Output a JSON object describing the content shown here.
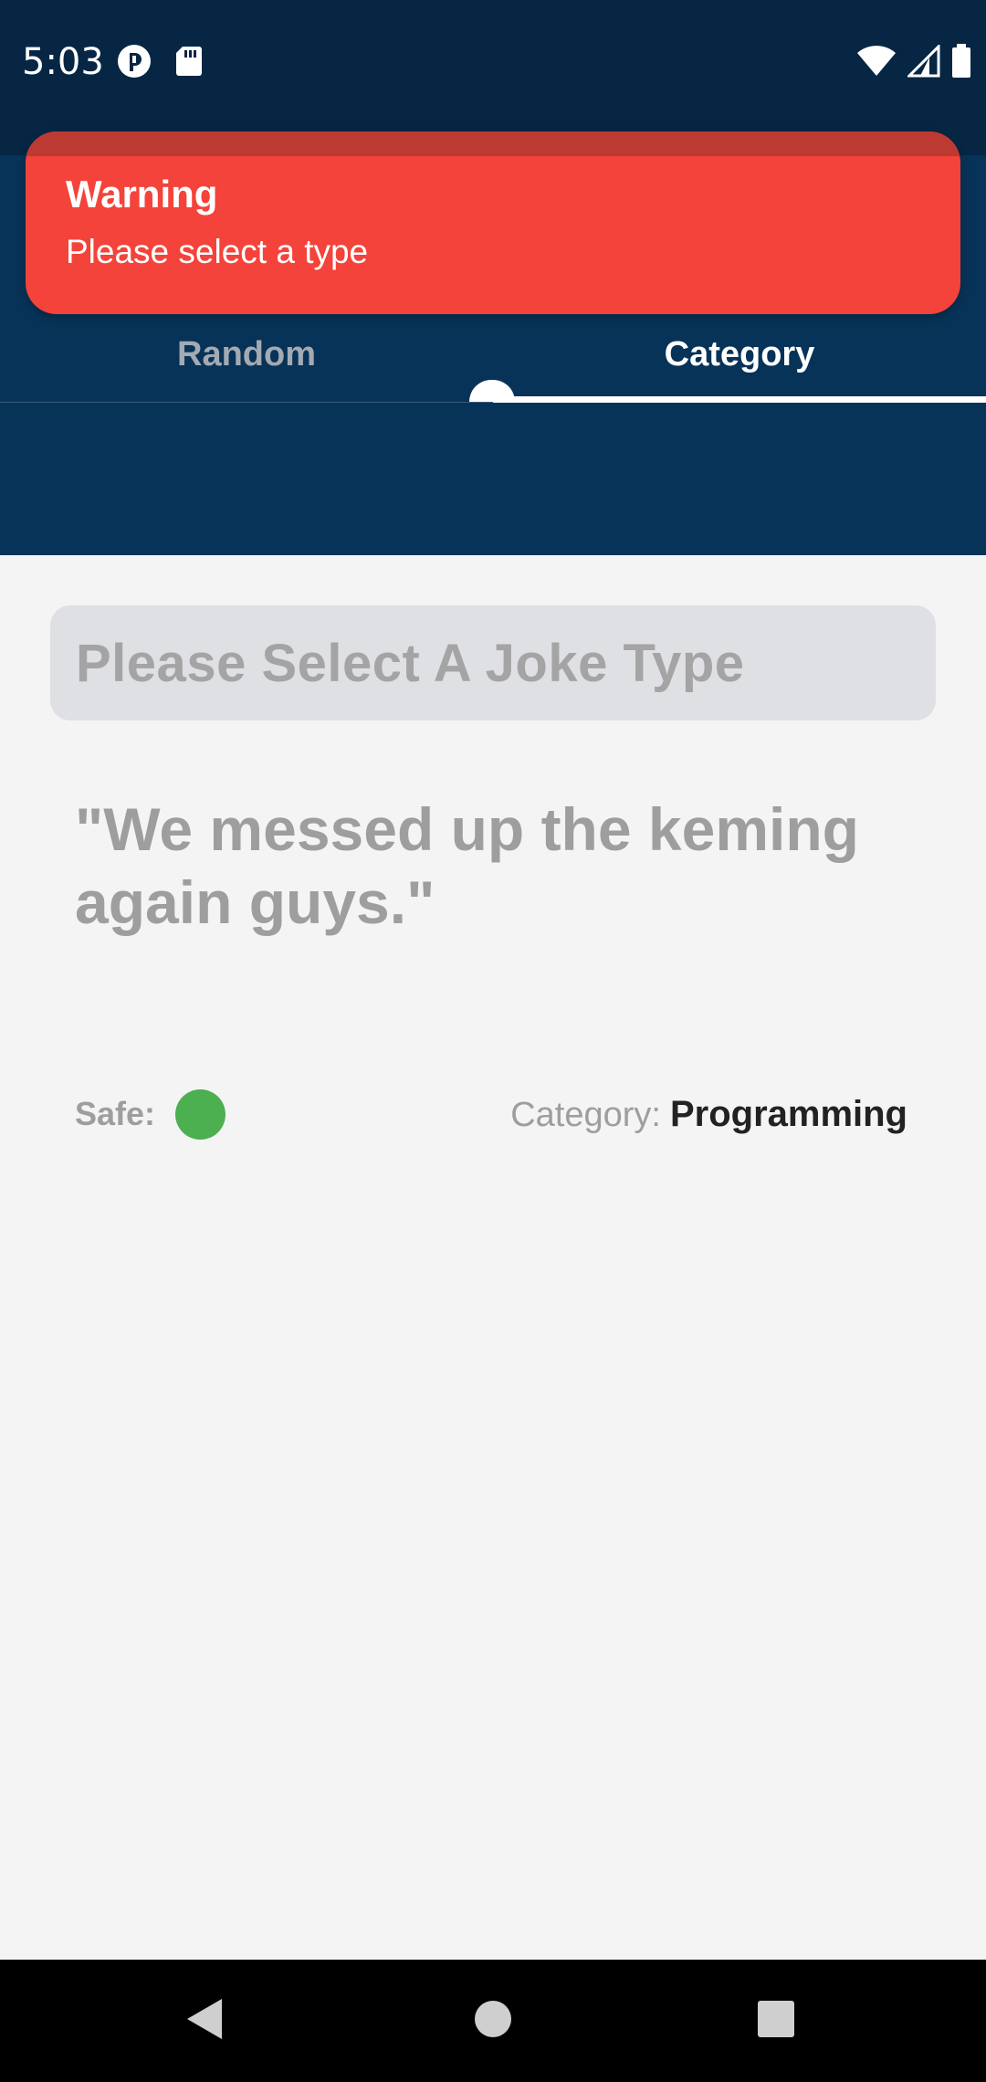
{
  "status_bar": {
    "time": "5:03",
    "left_icons": [
      "app-notification-icon",
      "sd-card-icon"
    ],
    "right_icons": [
      "wifi-icon",
      "cellular-signal-icon",
      "battery-icon"
    ]
  },
  "toast": {
    "title": "Warning",
    "message": "Please select a type",
    "color": "#f4433a"
  },
  "tabs": [
    {
      "label": "Random",
      "active": false
    },
    {
      "label": "Category",
      "active": true
    }
  ],
  "joke_type_select": {
    "placeholder": "Please Select A Joke Type"
  },
  "joke": {
    "text": "\"We messed up the keming again guys.\""
  },
  "info": {
    "safe_label": "Safe:",
    "safe_status_color": "#4caf50",
    "category_label": "Category:",
    "category_value": "Programming"
  },
  "nav_bar": {
    "buttons": [
      "back-icon",
      "home-icon",
      "recents-icon"
    ]
  },
  "colors": {
    "header": "#083358",
    "status_bar": "#062644",
    "background": "#f4f4f4"
  }
}
